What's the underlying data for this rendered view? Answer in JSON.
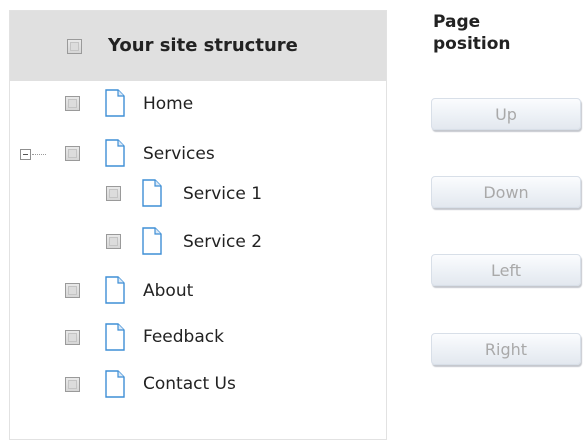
{
  "tree": {
    "header": {
      "title": "Your site structure"
    },
    "nodes": [
      {
        "label": "Home"
      },
      {
        "label": "Services",
        "children": [
          {
            "label": "Service 1"
          },
          {
            "label": "Service 2"
          }
        ]
      },
      {
        "label": "About"
      },
      {
        "label": "Feedback"
      },
      {
        "label": "Contact Us"
      }
    ]
  },
  "position": {
    "title": "Page position",
    "buttons": {
      "up": "Up",
      "down": "Down",
      "left": "Left",
      "right": "Right"
    }
  },
  "colors": {
    "header_bg": "#e0e0e0",
    "page_icon": "#3f8fd6",
    "disabled_text": "#a9a9a9"
  },
  "icons": {
    "page": "page-icon",
    "expander": "collapse-icon"
  }
}
